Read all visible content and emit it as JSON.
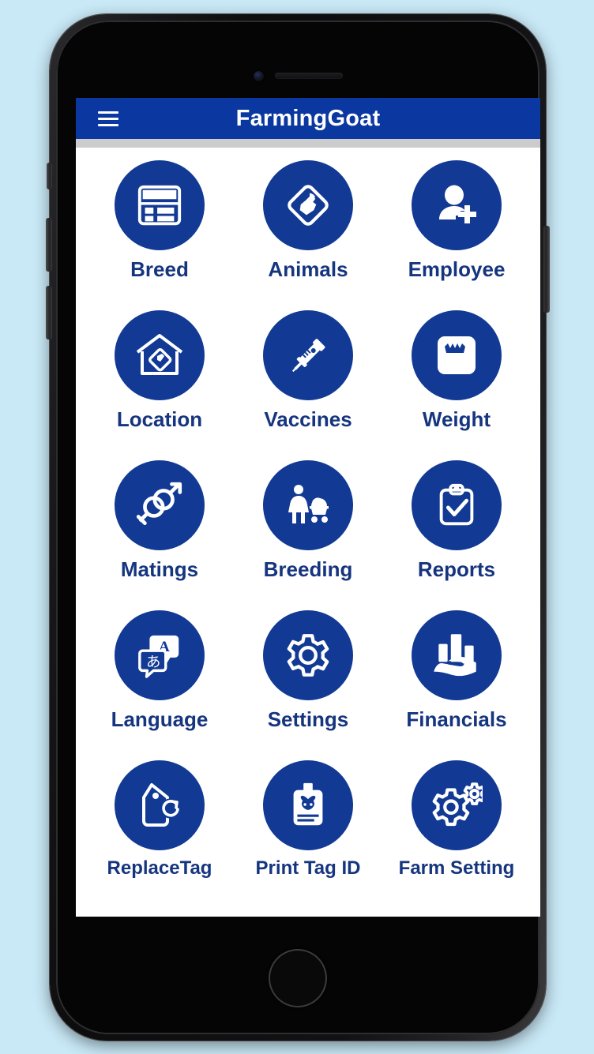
{
  "device": {
    "frame_color": "#121214",
    "background_color": "#c9e9f7",
    "buttons": {
      "mute_switch": "mute-switch",
      "volume_up": "volume-up",
      "volume_down": "volume-down",
      "power": "power"
    },
    "home_button_label": "home-button"
  },
  "app": {
    "title": "FarmingGoat",
    "accent_color": "#0b37a1",
    "icon_color": "#123a94",
    "label_color": "#16357f",
    "menu_label": "Menu"
  },
  "grid": {
    "columns": 3,
    "items": [
      {
        "label": "Breed",
        "icon": "table-card-icon",
        "name": "tile-breed"
      },
      {
        "label": "Animals",
        "icon": "diamond-goat-icon",
        "name": "tile-animals"
      },
      {
        "label": "Employee",
        "icon": "person-add-icon",
        "name": "tile-employee"
      },
      {
        "label": "Location",
        "icon": "barn-tag-icon",
        "name": "tile-location"
      },
      {
        "label": "Vaccines",
        "icon": "syringe-icon",
        "name": "tile-vaccines"
      },
      {
        "label": "Weight",
        "icon": "weight-scale-icon",
        "name": "tile-weight"
      },
      {
        "label": "Matings",
        "icon": "gender-symbols-icon",
        "name": "tile-matings"
      },
      {
        "label": "Breeding",
        "icon": "mother-stroller-icon",
        "name": "tile-breeding"
      },
      {
        "label": "Reports",
        "icon": "clipboard-check-icon",
        "name": "tile-reports"
      },
      {
        "label": "Language",
        "icon": "translate-bubbles-icon",
        "name": "tile-language"
      },
      {
        "label": "Settings",
        "icon": "gear-icon",
        "name": "tile-settings"
      },
      {
        "label": "Financials",
        "icon": "hand-bars-icon",
        "name": "tile-financials"
      },
      {
        "label": "ReplaceTag",
        "icon": "tag-refresh-icon",
        "name": "tile-replacetag"
      },
      {
        "label": "Print Tag ID",
        "icon": "id-card-goat-icon",
        "name": "tile-print-tag-id"
      },
      {
        "label": "Farm Setting",
        "icon": "double-gear-icon",
        "name": "tile-farm-setting"
      }
    ]
  }
}
